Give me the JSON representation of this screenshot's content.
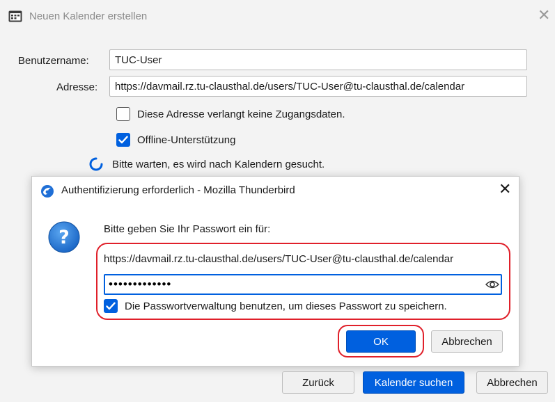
{
  "window": {
    "title": "Neuen Kalender erstellen",
    "close_label": "✕"
  },
  "form": {
    "username_label": "Benutzername:",
    "username_value": "TUC-User",
    "address_label": "Adresse:",
    "address_value": "https://davmail.rz.tu-clausthal.de/users/TUC-User@tu-clausthal.de/calendar",
    "no_credentials_label": "Diese Adresse verlangt keine Zugangsdaten.",
    "no_credentials_checked": false,
    "offline_label": "Offline-Unterstützung",
    "offline_checked": true,
    "waiting_text": "Bitte warten, es wird nach Kalendern gesucht."
  },
  "auth_dialog": {
    "title": "Authentifizierung erforderlich - Mozilla Thunderbird",
    "close_label": "✕",
    "prompt": "Bitte geben Sie Ihr Passwort ein für:",
    "url": "https://davmail.rz.tu-clausthal.de/users/TUC-User@tu-clausthal.de/calendar",
    "password_masked": "•••••••••••••",
    "remember_label": "Die Passwortverwaltung benutzen, um dieses Passwort zu speichern.",
    "remember_checked": true,
    "ok_label": "OK",
    "cancel_label": "Abbrechen"
  },
  "footer": {
    "back_label": "Zurück",
    "search_label": "Kalender suchen",
    "cancel_label": "Abbrechen"
  },
  "colors": {
    "accent": "#0060df",
    "highlight": "#e0202a",
    "background": "#f3f3f3"
  },
  "icons": {
    "app": "calendar-icon",
    "spinner": "loading-spinner-icon",
    "thunderbird": "thunderbird-icon",
    "question": "question-icon",
    "eye": "eye-icon"
  }
}
